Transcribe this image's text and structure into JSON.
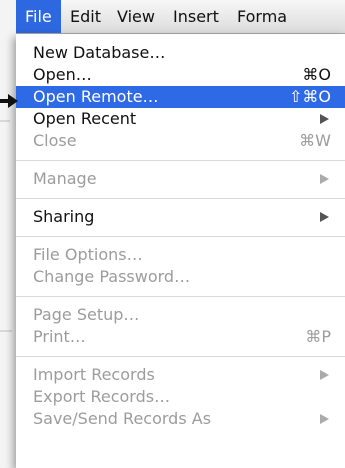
{
  "menubar": {
    "items": [
      "File",
      "Edit",
      "View",
      "Insert",
      "Forma"
    ],
    "active_index": 0
  },
  "file_menu": {
    "items": [
      {
        "label": "New Database…",
        "shortcut": "",
        "submenu": false,
        "enabled": true,
        "highlighted": false
      },
      {
        "label": "Open…",
        "shortcut": "⌘O",
        "submenu": false,
        "enabled": true,
        "highlighted": false
      },
      {
        "label": "Open Remote…",
        "shortcut": "⇧⌘O",
        "submenu": false,
        "enabled": true,
        "highlighted": true
      },
      {
        "label": "Open Recent",
        "shortcut": "",
        "submenu": true,
        "enabled": true,
        "highlighted": false
      },
      {
        "label": "Close",
        "shortcut": "⌘W",
        "submenu": false,
        "enabled": false,
        "highlighted": false
      },
      {
        "label": "Manage",
        "shortcut": "",
        "submenu": true,
        "enabled": false,
        "highlighted": false
      },
      {
        "label": "Sharing",
        "shortcut": "",
        "submenu": true,
        "enabled": true,
        "highlighted": false
      },
      {
        "label": "File Options…",
        "shortcut": "",
        "submenu": false,
        "enabled": false,
        "highlighted": false
      },
      {
        "label": "Change Password…",
        "shortcut": "",
        "submenu": false,
        "enabled": false,
        "highlighted": false
      },
      {
        "label": "Page Setup…",
        "shortcut": "",
        "submenu": false,
        "enabled": false,
        "highlighted": false
      },
      {
        "label": "Print…",
        "shortcut": "⌘P",
        "submenu": false,
        "enabled": false,
        "highlighted": false
      },
      {
        "label": "Import Records",
        "shortcut": "",
        "submenu": true,
        "enabled": false,
        "highlighted": false
      },
      {
        "label": "Export Records…",
        "shortcut": "",
        "submenu": false,
        "enabled": false,
        "highlighted": false
      },
      {
        "label": "Save/Send Records As",
        "shortcut": "",
        "submenu": true,
        "enabled": false,
        "highlighted": false
      }
    ]
  },
  "colors": {
    "highlight": "#2f6ae6",
    "disabled_text": "#9c9c9c",
    "text": "#111111"
  },
  "icons": {
    "pointer": "pointer-arrow-icon",
    "submenu": "chevron-right-icon"
  }
}
